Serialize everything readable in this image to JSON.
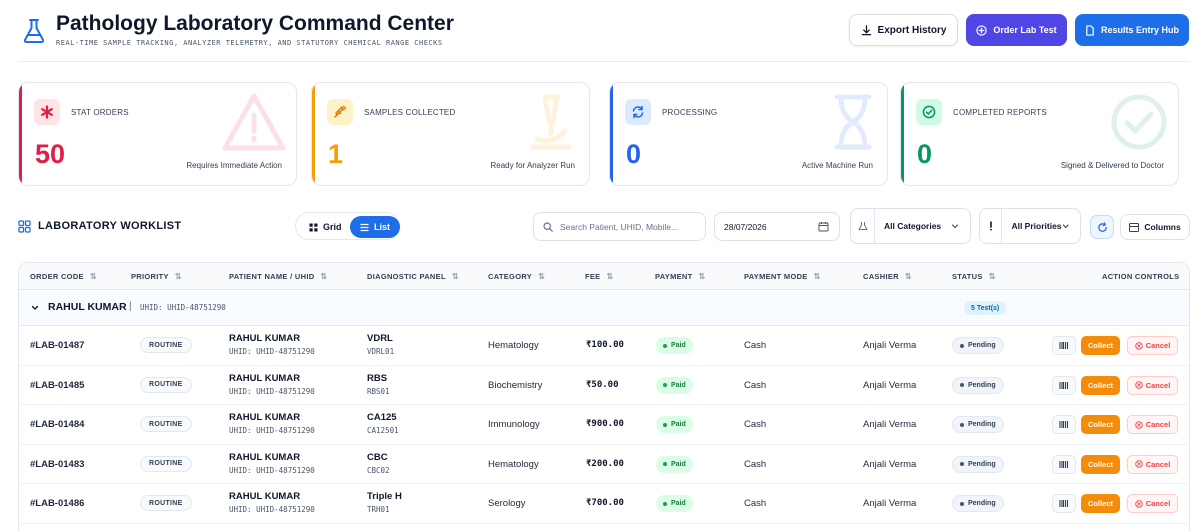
{
  "header": {
    "title": "Pathology Laboratory Command Center",
    "subtitle": "REAL-TIME SAMPLE TRACKING, ANALYZER TELEMETRY, AND STATUTORY CHEMICAL RANGE CHECKS",
    "logo_icon": "flask-icon",
    "buttons": {
      "export": "Export History",
      "order": "Order Lab Test",
      "results": "Results Entry Hub"
    }
  },
  "stats": [
    {
      "label": "STAT ORDERS",
      "value": "50",
      "note": "Requires Immediate Action",
      "icon": "asterisk-icon",
      "color": "#e11d48"
    },
    {
      "label": "SAMPLES COLLECTED",
      "value": "1",
      "note": "Ready for Analyzer Run",
      "icon": "syringe-icon",
      "color": "#f59e0b"
    },
    {
      "label": "PROCESSING",
      "value": "0",
      "note": "Active Machine Run",
      "icon": "sync-icon",
      "color": "#2563eb"
    },
    {
      "label": "COMPLETED REPORTS",
      "value": "0",
      "note": "Signed & Delivered to Doctor",
      "icon": "check-circle-icon",
      "color": "#059669"
    }
  ],
  "worklist": {
    "title": "LABORATORY WORKLIST",
    "view_grid": "Grid",
    "view_list": "List",
    "search_placeholder": "Search Patient, UHID, Mobile...",
    "date": "28/07/2026",
    "category": "All Categories",
    "priority": "All Priorities",
    "columns_label": "Columns"
  },
  "table": {
    "headers": [
      "ORDER CODE",
      "PRIORITY",
      "PATIENT NAME / UHID",
      "DIAGNOSTIC PANEL",
      "CATEGORY",
      "FEE",
      "PAYMENT",
      "PAYMENT MODE",
      "CASHIER",
      "STATUS",
      "ACTION CONTROLS"
    ],
    "group": {
      "name": "RAHUL KUMAR",
      "separator": "|",
      "uhid": "UHID: UHID-48751290",
      "badge": "5 Test(s)"
    },
    "action_collect": "Collect",
    "action_cancel": "Cancel",
    "rows": [
      {
        "code": "#LAB-01487",
        "priority": "ROUTINE",
        "patient": "RAHUL KUMAR",
        "uhid": "UHID: UHID-48751290",
        "test": "VDRL",
        "test_code": "VDRL01",
        "category": "Hematology",
        "fee": "₹100.00",
        "payment": "Paid",
        "mode": "Cash",
        "cashier": "Anjali Verma",
        "status": "Pending"
      },
      {
        "code": "#LAB-01485",
        "priority": "ROUTINE",
        "patient": "RAHUL KUMAR",
        "uhid": "UHID: UHID-48751290",
        "test": "RBS",
        "test_code": "RBS01",
        "category": "Biochemistry",
        "fee": "₹50.00",
        "payment": "Paid",
        "mode": "Cash",
        "cashier": "Anjali Verma",
        "status": "Pending"
      },
      {
        "code": "#LAB-01484",
        "priority": "ROUTINE",
        "patient": "RAHUL KUMAR",
        "uhid": "UHID: UHID-48751290",
        "test": "CA125",
        "test_code": "CA12501",
        "category": "Immunology",
        "fee": "₹900.00",
        "payment": "Paid",
        "mode": "Cash",
        "cashier": "Anjali Verma",
        "status": "Pending"
      },
      {
        "code": "#LAB-01483",
        "priority": "ROUTINE",
        "patient": "RAHUL KUMAR",
        "uhid": "UHID: UHID-48751290",
        "test": "CBC",
        "test_code": "CBC02",
        "category": "Hematology",
        "fee": "₹200.00",
        "payment": "Paid",
        "mode": "Cash",
        "cashier": "Anjali Verma",
        "status": "Pending"
      },
      {
        "code": "#LAB-01486",
        "priority": "ROUTINE",
        "patient": "RAHUL KUMAR",
        "uhid": "UHID: UHID-48751290",
        "test": "Triple H",
        "test_code": "TRH01",
        "category": "Serology",
        "fee": "₹700.00",
        "payment": "Paid",
        "mode": "Cash",
        "cashier": "Anjali Verma",
        "status": "Pending"
      }
    ]
  }
}
